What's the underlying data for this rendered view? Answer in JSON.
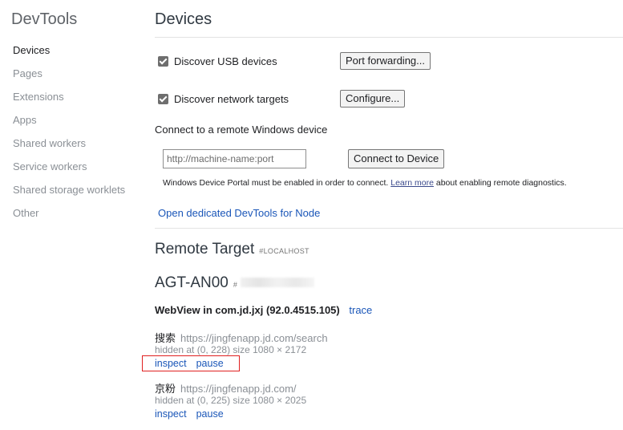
{
  "sidebar": {
    "title": "DevTools",
    "items": [
      {
        "label": "Devices"
      },
      {
        "label": "Pages"
      },
      {
        "label": "Extensions"
      },
      {
        "label": "Apps"
      },
      {
        "label": "Shared workers"
      },
      {
        "label": "Service workers"
      },
      {
        "label": "Shared storage worklets"
      },
      {
        "label": "Other"
      }
    ],
    "active_item": "Devices"
  },
  "main": {
    "title": "Devices",
    "discover_usb": {
      "label": "Discover USB devices",
      "checked": true,
      "button": "Port forwarding..."
    },
    "discover_network": {
      "label": "Discover network targets",
      "checked": true,
      "button": "Configure..."
    },
    "remote_windows": {
      "label": "Connect to a remote Windows device",
      "input_placeholder": "http://machine-name:port",
      "button": "Connect to Device",
      "note_before": "Windows Device Portal must be enabled in order to connect.",
      "note_link": "Learn more",
      "note_after": "about enabling remote diagnostics."
    },
    "node_link": "Open dedicated DevTools for Node",
    "remote_target": {
      "title": "Remote Target",
      "tag": "#LOCALHOST"
    },
    "device": {
      "name": "AGT-AN00",
      "serial_prefix": "#",
      "webview": {
        "label": "WebView in com.jd.jxj (92.0.4515.105)",
        "trace_link": "trace"
      },
      "pages": [
        {
          "name": "搜索",
          "url": "https://jingfenapp.jd.com/search",
          "meta": "hidden  at (0, 228)  size 1080 × 2172",
          "inspect": "inspect",
          "pause": "pause"
        },
        {
          "name": "京粉",
          "url": "https://jingfenapp.jd.com/",
          "meta": "hidden  at (0, 225)  size 1080 × 2025",
          "inspect": "inspect",
          "pause": "pause"
        }
      ]
    }
  },
  "colors": {
    "link": "#1a56b8",
    "highlight": "#e02020",
    "muted": "#8a8f95"
  }
}
